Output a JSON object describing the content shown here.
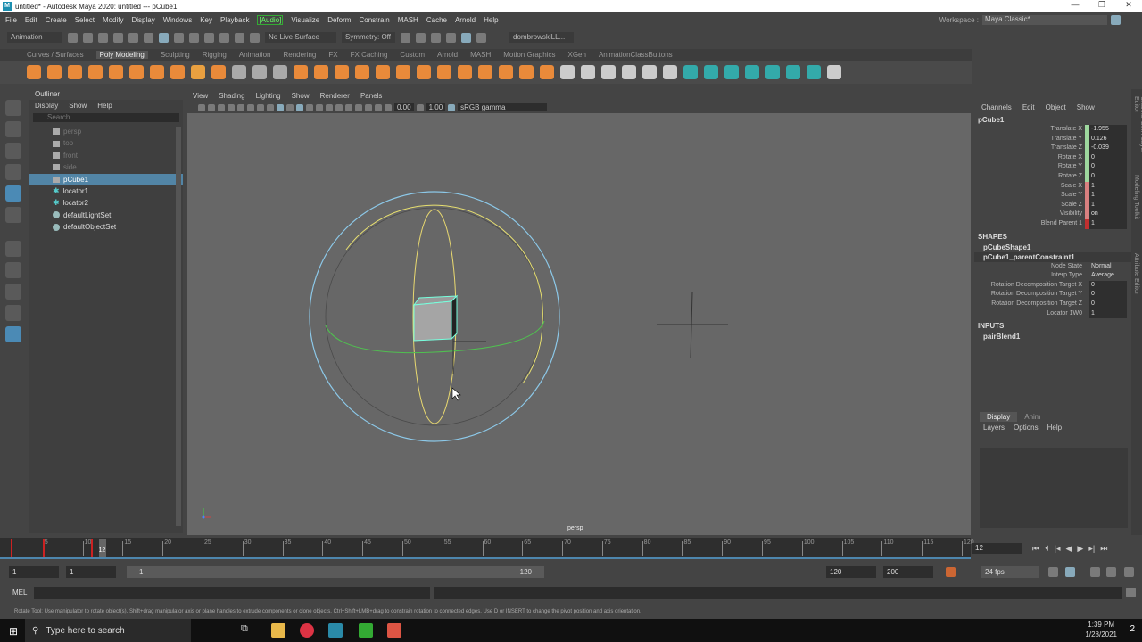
{
  "window": {
    "title": "untitled* - Autodesk Maya 2020: untitled  ---  pCube1",
    "controls": [
      "—",
      "❐",
      "✕"
    ]
  },
  "menubar": [
    "File",
    "Edit",
    "Create",
    "Select",
    "Modify",
    "Display",
    "Windows",
    "Key",
    "Playback",
    "[Audio]",
    "Visualize",
    "Deform",
    "Constrain",
    "MASH",
    "Cache",
    "Arnold",
    "Help"
  ],
  "workspace": {
    "label": "Workspace :",
    "value": "Maya Classic*"
  },
  "statusline": {
    "mode": "Animation",
    "live_surface": "No Live Surface",
    "symmetry": "Symmetry: Off",
    "user": "dombrowskiLL..."
  },
  "shelf_tabs": [
    "Curves / Surfaces",
    "Poly Modeling",
    "Sculpting",
    "Rigging",
    "Animation",
    "Rendering",
    "FX",
    "FX Caching",
    "Custom",
    "Arnold",
    "MASH",
    "Motion Graphics",
    "XGen",
    "AnimationClassButtons"
  ],
  "shelf_active": "Poly Modeling",
  "outliner": {
    "title": "Outliner",
    "menu": [
      "Display",
      "Show",
      "Help"
    ],
    "search_placeholder": "Search...",
    "items": [
      {
        "label": "persp",
        "type": "camera",
        "dim": true
      },
      {
        "label": "top",
        "type": "camera",
        "dim": true
      },
      {
        "label": "front",
        "type": "camera",
        "dim": true
      },
      {
        "label": "side",
        "type": "camera",
        "dim": true
      },
      {
        "label": "pCube1",
        "type": "transform",
        "selected": true
      },
      {
        "label": "locator1",
        "type": "locator"
      },
      {
        "label": "locator2",
        "type": "locator"
      },
      {
        "label": "defaultLightSet",
        "type": "set"
      },
      {
        "label": "defaultObjectSet",
        "type": "set"
      }
    ]
  },
  "viewport": {
    "menu": [
      "View",
      "Shading",
      "Lighting",
      "Show",
      "Renderer",
      "Panels"
    ],
    "exposure": "0.00",
    "gamma": "1.00",
    "colorspace": "sRGB gamma",
    "camera_label": "persp"
  },
  "channel_box": {
    "menu": [
      "Channels",
      "Edit",
      "Object",
      "Show"
    ],
    "object": "pCube1",
    "channels": [
      {
        "name": "Translate X",
        "value": "-1.955",
        "color": "#9ed89e"
      },
      {
        "name": "Translate Y",
        "value": "0.126",
        "color": "#9ed89e"
      },
      {
        "name": "Translate Z",
        "value": "-0.039",
        "color": "#9ed89e"
      },
      {
        "name": "Rotate X",
        "value": "0",
        "color": "#9ed89e"
      },
      {
        "name": "Rotate Y",
        "value": "0",
        "color": "#9ed89e"
      },
      {
        "name": "Rotate Z",
        "value": "0",
        "color": "#9ed89e"
      },
      {
        "name": "Scale X",
        "value": "1",
        "color": "#d98080"
      },
      {
        "name": "Scale Y",
        "value": "1",
        "color": "#d98080"
      },
      {
        "name": "Scale Z",
        "value": "1",
        "color": "#d98080"
      },
      {
        "name": "Visibility",
        "value": "on",
        "color": "#d98080"
      },
      {
        "name": "Blend Parent 1",
        "value": "1",
        "color": "#c23030"
      }
    ],
    "shapes_label": "SHAPES",
    "shapes": [
      "pCubeShape1",
      "pCube1_parentConstraint1"
    ],
    "constraint_attrs": [
      {
        "name": "Node State",
        "value": "Normal",
        "plain": true
      },
      {
        "name": "Interp Type",
        "value": "Average",
        "plain": true
      },
      {
        "name": "Rotation Decomposition Target X",
        "value": "0"
      },
      {
        "name": "Rotation Decomposition Target Y",
        "value": "0"
      },
      {
        "name": "Rotation Decomposition Target Z",
        "value": "0"
      },
      {
        "name": "Locator 1W0",
        "value": "1"
      }
    ],
    "inputs_label": "INPUTS",
    "inputs": [
      "pairBlend1"
    ]
  },
  "layer_editor": {
    "tabs": [
      "Display",
      "Anim"
    ],
    "menu": [
      "Layers",
      "Options",
      "Help"
    ]
  },
  "side_tabs": [
    "Channel Box / Layer Editor",
    "Modeling Toolkit",
    "Attribute Editor"
  ],
  "timeline": {
    "ticks": [
      5,
      10,
      15,
      20,
      25,
      30,
      35,
      40,
      45,
      50,
      55,
      60,
      65,
      70,
      75,
      80,
      85,
      90,
      95,
      100,
      105,
      110,
      115,
      120
    ],
    "start": 1,
    "end": 120,
    "current": 12,
    "keys": [
      1,
      5,
      11
    ],
    "current_field": "12"
  },
  "range": {
    "start": "1",
    "playback_start": "1",
    "slider_start": "1",
    "slider_end": "120",
    "playback_end": "120",
    "end": "200",
    "fps": "24 fps"
  },
  "mel": {
    "label": "MEL"
  },
  "help_line": "Rotate Tool: Use manipulator to rotate object(s). Shift+drag manipulator axis or plane handles to extrude components or clone objects. Ctrl+Shift+LMB+drag to constrain rotation to connected edges. Use D or INSERT to change the pivot position and axis orientation.",
  "taskbar": {
    "search_placeholder": "Type here to search",
    "time": "1:39 PM",
    "date": "1/28/2021",
    "notifications": "2"
  }
}
